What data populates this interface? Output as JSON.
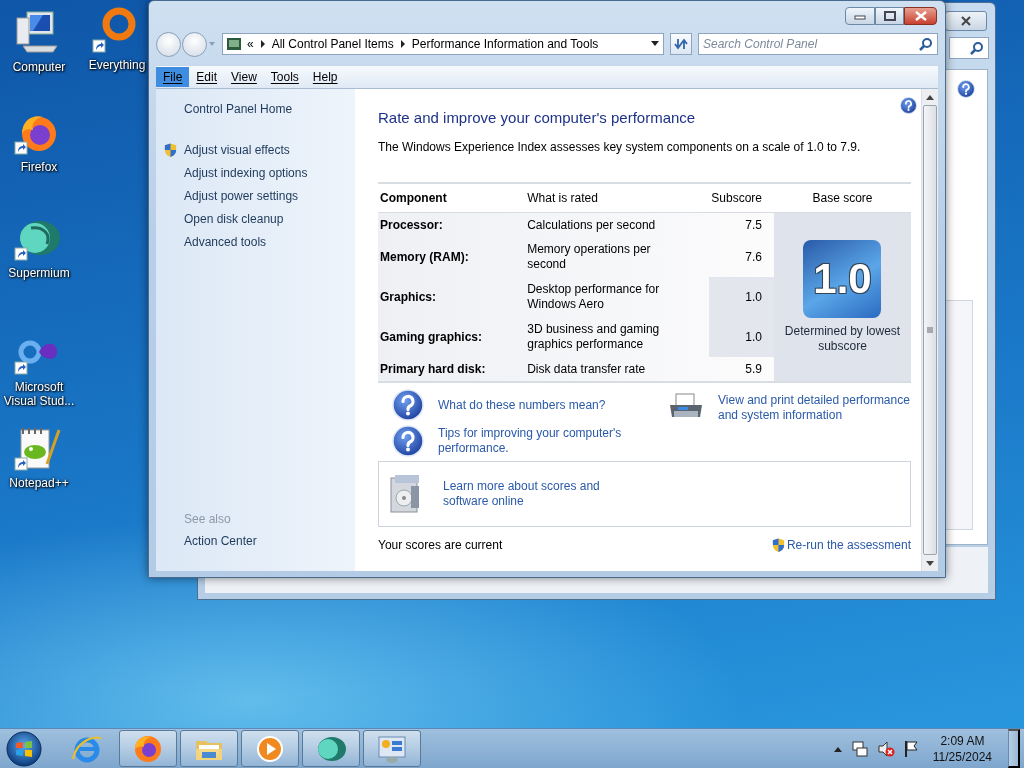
{
  "desktop_icons": [
    {
      "label": "Computer",
      "kind": "computer",
      "shortcut": false
    },
    {
      "label": "Everything",
      "kind": "everything",
      "shortcut": true
    },
    {
      "label": "Firefox",
      "kind": "firefox",
      "shortcut": true
    },
    {
      "label": "Supermium",
      "kind": "supermium",
      "shortcut": true
    },
    {
      "label": "Microsoft Visual Stud...",
      "kind": "visual-studio",
      "shortcut": true
    },
    {
      "label": "Notepad++",
      "kind": "notepad",
      "shortcut": true
    }
  ],
  "window": {
    "address": {
      "prefix": "«",
      "crumbs": [
        "All Control Panel Items",
        "Performance Information and Tools"
      ]
    },
    "search": {
      "placeholder": "Search Control Panel"
    },
    "menu": [
      {
        "label": "File",
        "selected": true
      },
      {
        "label": "Edit",
        "selected": false
      },
      {
        "label": "View",
        "selected": false
      },
      {
        "label": "Tools",
        "selected": false
      },
      {
        "label": "Help",
        "selected": false
      }
    ],
    "sidebar": {
      "home": "Control Panel Home",
      "tasks": [
        {
          "label": "Adjust visual effects",
          "shield": true
        },
        {
          "label": "Adjust indexing options",
          "shield": false
        },
        {
          "label": "Adjust power settings",
          "shield": false
        },
        {
          "label": "Open disk cleanup",
          "shield": false
        },
        {
          "label": "Advanced tools",
          "shield": false
        }
      ],
      "see_also_heading": "See also",
      "see_also": [
        "Action Center"
      ]
    },
    "content": {
      "title": "Rate and improve your computer's performance",
      "description": "The Windows Experience Index assesses key system components on a scale of 1.0 to 7.9.",
      "table": {
        "columns": [
          "Component",
          "What is rated",
          "Subscore",
          "Base score"
        ],
        "rows": [
          {
            "component": "Processor:",
            "rated": "Calculations per second",
            "subscore": "7.5",
            "lowest": false
          },
          {
            "component": "Memory (RAM):",
            "rated": "Memory operations per second",
            "subscore": "7.6",
            "lowest": false
          },
          {
            "component": "Graphics:",
            "rated": "Desktop performance for Windows Aero",
            "subscore": "1.0",
            "lowest": true
          },
          {
            "component": "Gaming graphics:",
            "rated": "3D business and gaming graphics performance",
            "subscore": "1.0",
            "lowest": true
          },
          {
            "component": "Primary hard disk:",
            "rated": "Disk data transfer rate",
            "subscore": "5.9",
            "lowest": false
          }
        ]
      },
      "base_score": {
        "value": "1.0",
        "caption": "Determined by lowest subscore"
      },
      "help_links": [
        "What do these numbers mean?",
        "Tips for improving your computer's performance."
      ],
      "print_link": "View and print detailed performance and system information",
      "learn_more": "Learn more about scores and software online",
      "status": "Your scores are current",
      "rerun": "Re-run the assessment"
    }
  },
  "taskbar": {
    "apps": [
      {
        "kind": "ie",
        "running": false
      },
      {
        "kind": "firefox",
        "running": true
      },
      {
        "kind": "explorer",
        "running": true
      },
      {
        "kind": "media",
        "running": true
      },
      {
        "kind": "supermium",
        "running": true
      },
      {
        "kind": "control-panel",
        "running": true
      }
    ],
    "time": "2:09 AM",
    "date": "11/25/2024"
  }
}
